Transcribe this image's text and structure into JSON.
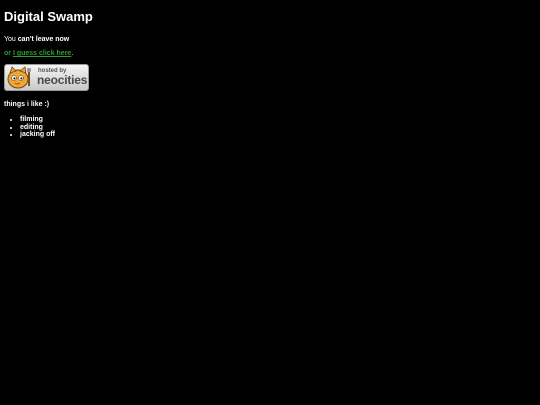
{
  "page": {
    "title": "Digital Swamp",
    "line1_prefix": "You ",
    "line1_strong": "can't leave now",
    "line2_prefix": "or ",
    "line2_link": "I guess click here",
    "line2_suffix": ".",
    "badge_small": "hosted by",
    "badge_big": "neocities",
    "things_heading": "things i like :)",
    "things": [
      "filming",
      "editing",
      "jacking off"
    ]
  },
  "colors": {
    "background": "#000000",
    "text": "#ffffff",
    "link": "#2e9e2e"
  },
  "icons": {
    "badge_mascot": "neocities-cat-icon"
  }
}
